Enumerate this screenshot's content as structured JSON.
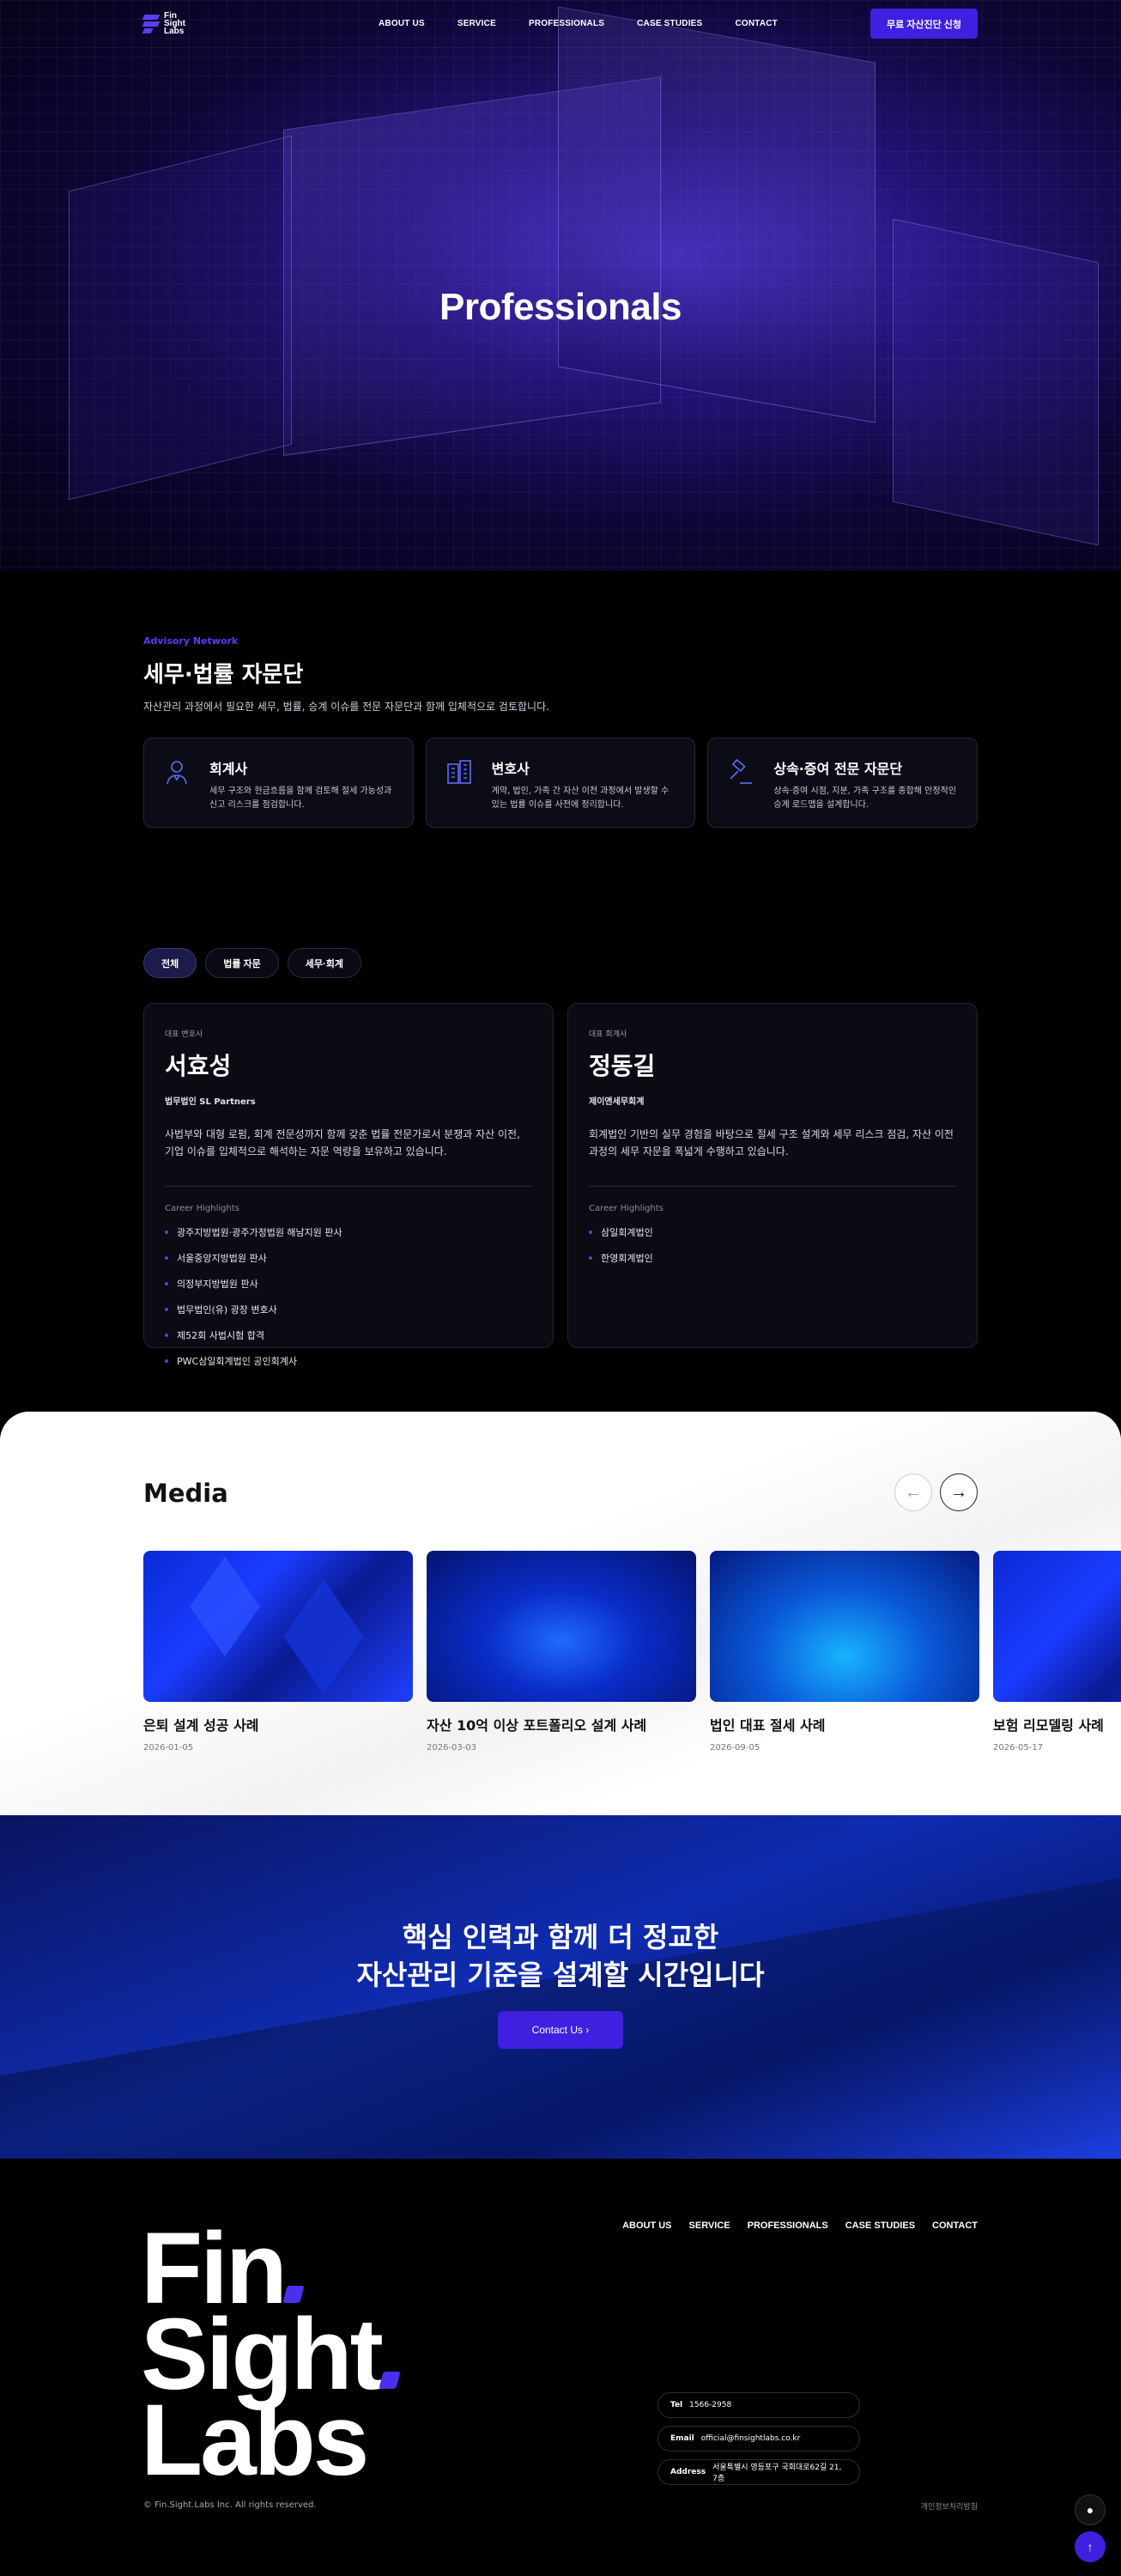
{
  "header": {
    "logo_lines": [
      "Fin",
      "Sight",
      "Labs"
    ],
    "nav": [
      "ABOUT US",
      "SERVICE",
      "PROFESSIONALS",
      "CASE STUDIES",
      "CONTACT"
    ],
    "cta": "무료 자산진단 신청"
  },
  "hero": {
    "title": "Professionals"
  },
  "advisory": {
    "eyebrow": "Advisory Network",
    "title": "세무·법률 자문단",
    "desc": "자산관리 과정에서 필요한 세무, 법률, 승계 이슈를 전문 자문단과 함께 입체적으로 검토합니다.",
    "cards": [
      {
        "icon": "accountant-icon",
        "title": "회계사",
        "desc": "세무 구조와 현금흐름을 함께 검토해 절세 가능성과 신고 리스크를 점검합니다."
      },
      {
        "icon": "building-icon",
        "title": "변호사",
        "desc": "계약, 법인, 가족 간 자산 이전 과정에서 발생할 수 있는 법률 이슈를 사전에 정리합니다."
      },
      {
        "icon": "gavel-icon",
        "title": "상속·증여 전문 자문단",
        "desc": "상속·증여 시점, 지분, 가족 구조를 종합해 안정적인 승계 로드맵을 설계합니다."
      }
    ]
  },
  "filters": [
    "전체",
    "법률 자문",
    "세무·회계"
  ],
  "professionals": [
    {
      "role": "대표 변호사",
      "name": "서효성",
      "firm": "법무법인 SL Partners",
      "bio": "사법부와 대형 로펌, 회계 전문성까지 함께 갖춘 법률 전문가로서 분쟁과 자산 이전, 기업 이슈를 입체적으로 해석하는 자문 역량을 보유하고 있습니다.",
      "highlights_label": "Career Highlights",
      "highlights": [
        "광주지방법원·광주가정법원 해남지원 판사",
        "서울중앙지방법원 판사",
        "의정부지방법원 판사",
        "법무법인(유) 광장 변호사",
        "제52회 사법시험 합격",
        "PWC삼일회계법인 공인회계사"
      ]
    },
    {
      "role": "대표 회계사",
      "name": "정동길",
      "firm": "제이앤세무회계",
      "bio": "회계법인 기반의 실무 경험을 바탕으로 절세 구조 설계와 세무 리스크 점검, 자산 이전 과정의 세무 자문을 폭넓게 수행하고 있습니다.",
      "highlights_label": "Career Highlights",
      "highlights": [
        "삼일회계법인",
        "한영회계법인"
      ]
    }
  ],
  "media": {
    "title": "Media",
    "items": [
      {
        "title": "은퇴 설계 성공 사례",
        "date": "2026-01-05"
      },
      {
        "title": "자산 10억 이상 포트폴리오 설계 사례",
        "date": "2026-03-03"
      },
      {
        "title": "법인 대표 절세 사례",
        "date": "2026-09-05"
      },
      {
        "title": "보험 리모델링 사례",
        "date": "2026-05-17"
      }
    ]
  },
  "banner": {
    "line1": "핵심 인력과 함께 더 정교한",
    "line2": "자산관리 기준을 설계할 시간입니다",
    "button": "Contact Us  ›"
  },
  "footer": {
    "big_words": [
      "Fin",
      "Sight",
      "Labs"
    ],
    "nav": [
      "ABOUT US",
      "SERVICE",
      "PROFESSIONALS",
      "CASE STUDIES",
      "CONTACT"
    ],
    "tel_label": "Tel",
    "tel": "1566-2958",
    "email_label": "Email",
    "email": "official@finsightlabs.co.kr",
    "address_label": "Address",
    "address": "서울특별시 영등포구 국회대로62길 21, 7층",
    "copyright": "© Fin.Sight.Labs Inc. All rights reserved.",
    "privacy": "개인정보처리방침"
  },
  "colors": {
    "accent": "#3f1fe0",
    "brand_violet": "#5b3cf5",
    "bg": "#000000"
  }
}
